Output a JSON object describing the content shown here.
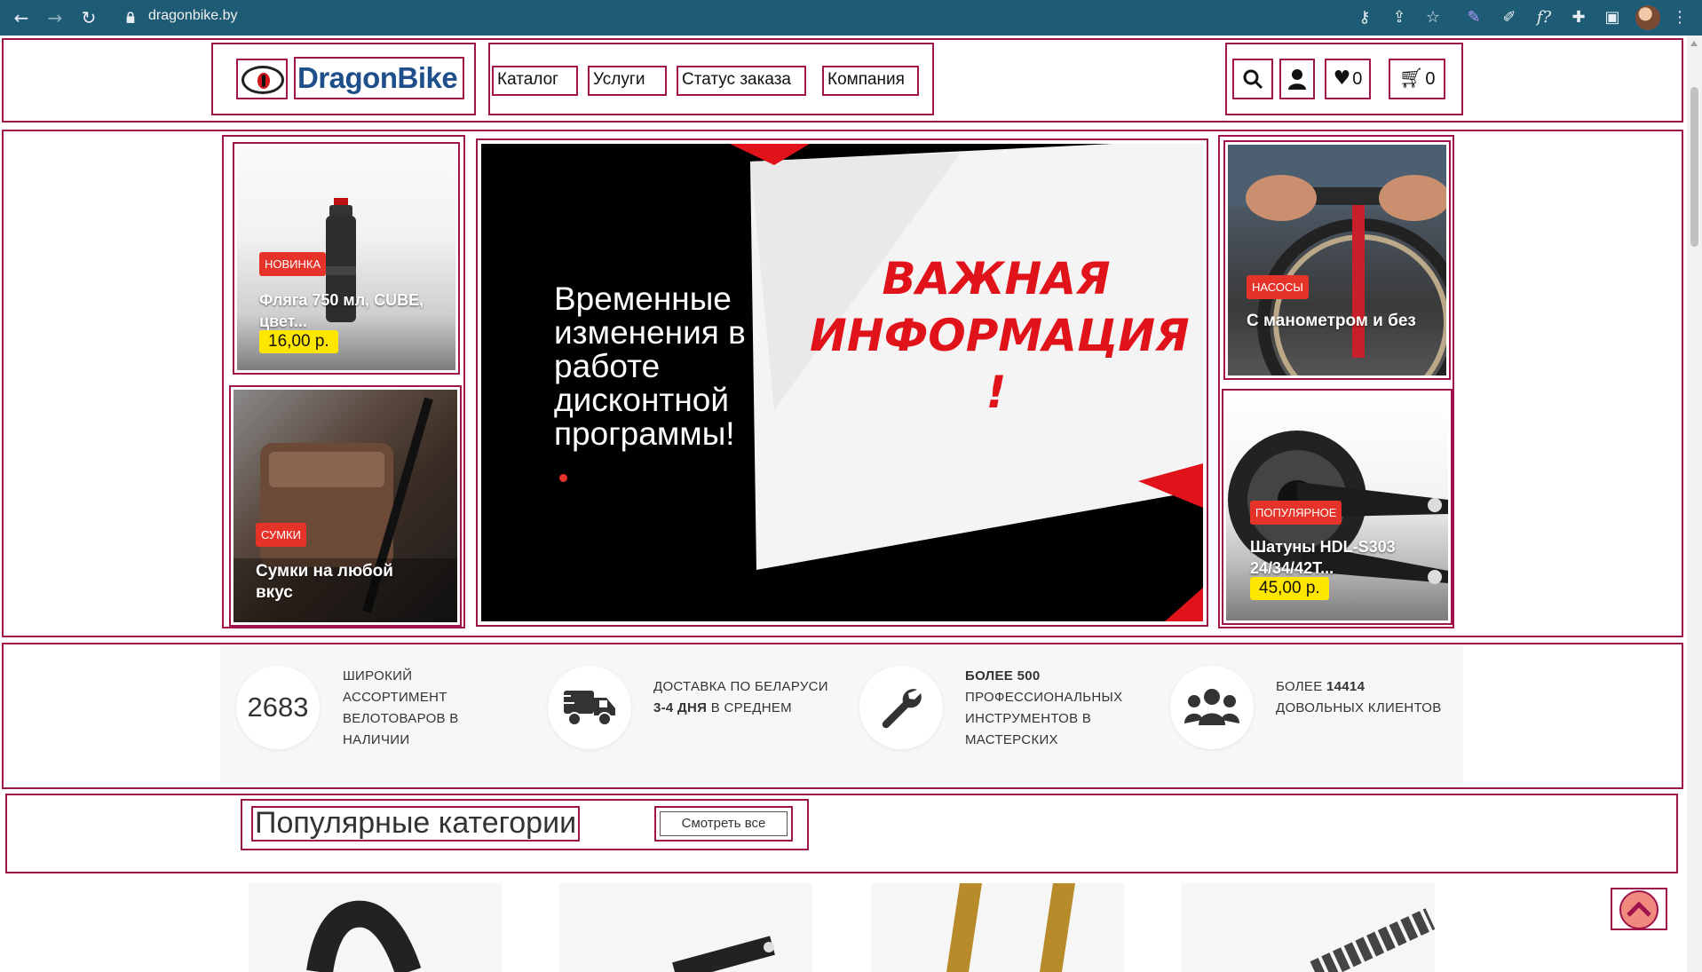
{
  "browser": {
    "url": "dragonbike.by",
    "icons": [
      "back-icon",
      "forward-icon",
      "reload-icon",
      "lock-icon",
      "key-icon",
      "share-icon",
      "star-icon",
      "pen-icon",
      "brush-icon",
      "fx-icon",
      "puzzle-icon",
      "sidepanel-icon",
      "avatar-icon",
      "menu-icon"
    ],
    "fx_label": "f?"
  },
  "header": {
    "logo_text": "DragonBike",
    "menu": [
      "Каталог",
      "Услуги",
      "Статус заказа",
      "Компания"
    ],
    "favorites_count": "0",
    "cart_count": "0"
  },
  "hero": {
    "left_top": {
      "badge": "НОВИНКА",
      "title": "Фляга 750 мл, CUBE, цвет...",
      "price": "16,00 р."
    },
    "left_bottom": {
      "badge": "СУМКИ",
      "title": "Сумки на любой вкус"
    },
    "banner": {
      "text": "Временные изменения в работе дисконтной программы!",
      "headline": "ВАЖНАЯ ИНФОРМАЦИЯ !"
    },
    "right_top": {
      "badge": "НАСОСЫ",
      "title": "С манометром и без"
    },
    "right_bottom": {
      "badge": "ПОПУЛЯРНОЕ",
      "title": "Шатуны HDL-S303 24/34/42T...",
      "price": "45,00 р."
    }
  },
  "features": [
    {
      "stat": "2683",
      "text": "Широкий ассортимент велотоваров в наличии"
    },
    {
      "icon": "truck-icon",
      "text_pre": "Доставка по Беларуси ",
      "text_bold": "3-4 дня",
      "text_post": " в среднем"
    },
    {
      "icon": "wrench-icon",
      "text_pre": "",
      "text_bold": "Более 500",
      "text_post": " профессиональных инструментов в мастерских"
    },
    {
      "icon": "users-icon",
      "text_pre": "Более ",
      "text_bold": "14414",
      "text_post": " довольных клиентов"
    }
  ],
  "categories": {
    "title": "Популярные категории",
    "see_all": "Смотреть все"
  },
  "colors": {
    "chrome_bg": "#1e5b74",
    "outline": "#a0144b",
    "badge": "#e6332a",
    "price_bg": "#ffe600",
    "logo": "#1e4f8a"
  }
}
